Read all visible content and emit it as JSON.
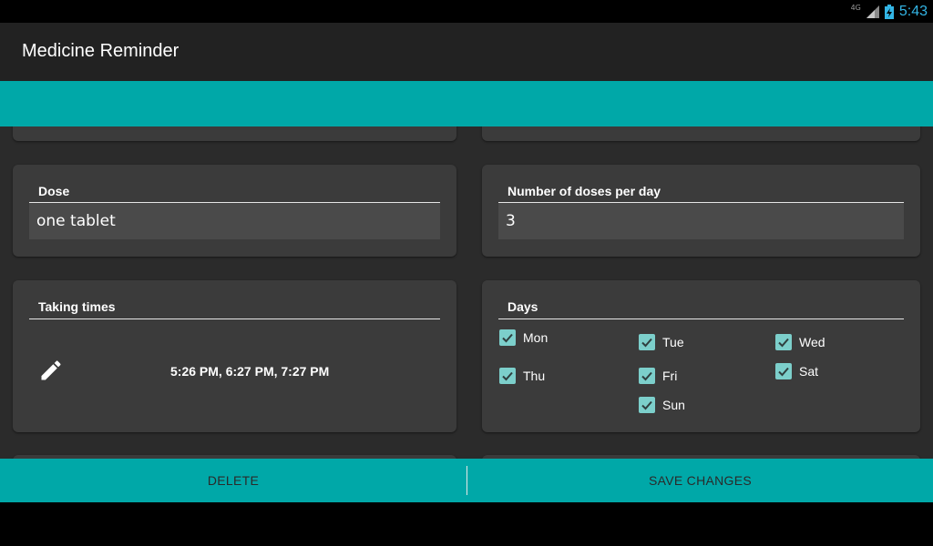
{
  "status": {
    "network": "4G",
    "time": "5:43"
  },
  "app": {
    "title": "Medicine Reminder"
  },
  "dose": {
    "label": "Dose",
    "value": "one tablet"
  },
  "doses_per_day": {
    "label": "Number of doses per day",
    "value": "3"
  },
  "taking_times": {
    "label": "Taking times",
    "value": "5:26 PM, 6:27 PM, 7:27 PM"
  },
  "days": {
    "label": "Days",
    "items": [
      {
        "label": "Mon",
        "checked": true
      },
      {
        "label": "Tue",
        "checked": true
      },
      {
        "label": "Wed",
        "checked": true
      },
      {
        "label": "Thu",
        "checked": true
      },
      {
        "label": "Fri",
        "checked": true
      },
      {
        "label": "Sat",
        "checked": true
      },
      {
        "label": "Sun",
        "checked": true
      }
    ]
  },
  "actions": {
    "delete_label": "DELETE",
    "save_label": "SAVE CHANGES"
  },
  "colors": {
    "accent": "#00a8a8",
    "checkbox": "#7ccfcb",
    "clock": "#33b5e5",
    "card": "#3b3b3b",
    "background": "#2b2b2b"
  }
}
